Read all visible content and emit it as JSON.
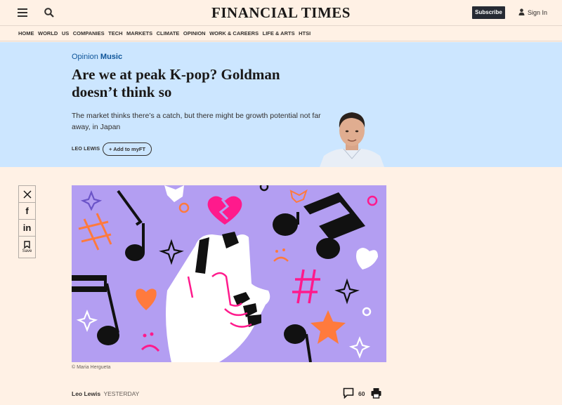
{
  "header": {
    "brand": "FINANCIAL TIMES",
    "subscribe_label": "Subscribe",
    "signin_label": "Sign In",
    "icons": [
      "menu-icon",
      "search-icon",
      "person-icon"
    ]
  },
  "nav": {
    "items": [
      "HOME",
      "WORLD",
      "US",
      "COMPANIES",
      "TECH",
      "MARKETS",
      "CLIMATE",
      "OPINION",
      "WORK & CAREERS",
      "LIFE & ARTS",
      "HTSI"
    ]
  },
  "article": {
    "section": "Opinion",
    "topic": "Music",
    "headline": "Are we at peak K-pop? Goldman doesn’t think so",
    "standfirst": "The market thinks there’s a catch, but there might be growth potential not far away, in Japan",
    "byline": "LEO LEWIS",
    "add_myft": "Add to myFT",
    "image_credit": "© Maria Hergueta",
    "author": "Leo Lewis",
    "published": "YESTERDAY",
    "comment_count": "60"
  },
  "share": {
    "save_label": "Save",
    "icons": [
      "x-icon",
      "facebook-icon",
      "linkedin-icon",
      "bookmark-icon"
    ]
  },
  "colors": {
    "page_bg": "#fff1e5",
    "hero_bg": "#cce6ff",
    "accent_blue": "#0d5499",
    "subscribe_bg": "#262a33",
    "illustration_bg": "#b39ef2",
    "pink": "#ff1a8c",
    "orange": "#ff7a3d"
  }
}
